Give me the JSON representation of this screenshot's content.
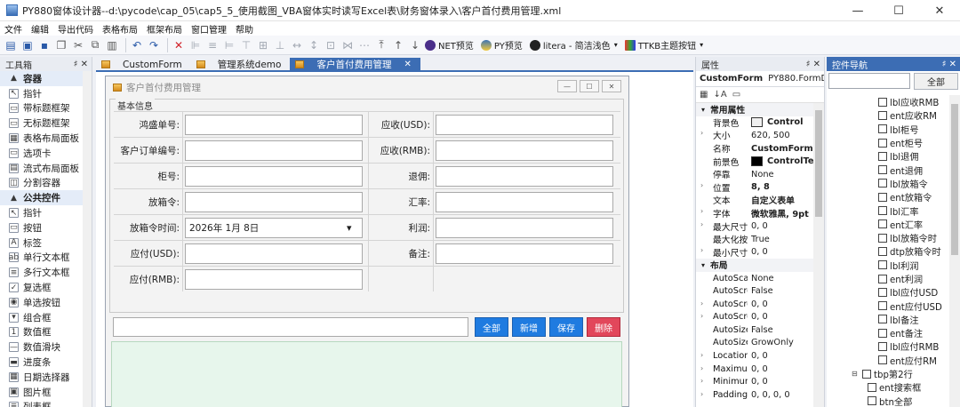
{
  "window": {
    "title": "PY880窗体设计器--d:\\pycode\\cap_05\\cap5_5_使用截图_VBA窗体实时读写Excel表\\财务窗体录入\\客户首付费用管理.xml",
    "minimize": "—",
    "maximize": "☐",
    "close": "✕"
  },
  "menu": [
    "文件",
    "编辑",
    "导出代码",
    "表格布局",
    "框架布局",
    "窗口管理",
    "帮助"
  ],
  "toolbar": {
    "net_preview": "NET预览",
    "py_preview": "PY预览",
    "litera": "litera - 简洁浅色",
    "ttkb": "TTKB主题按钮"
  },
  "toolbox": {
    "title": "工具箱",
    "pin": "♯ ✕",
    "items": [
      {
        "label": "容器",
        "icon": "▲",
        "cat": true
      },
      {
        "label": "指针",
        "icon": "↖"
      },
      {
        "label": "带标题框架",
        "icon": "▭"
      },
      {
        "label": "无标题框架",
        "icon": "▭"
      },
      {
        "label": "表格布局面板",
        "icon": "▦"
      },
      {
        "label": "选项卡",
        "icon": "▭"
      },
      {
        "label": "流式布局面板",
        "icon": "▤"
      },
      {
        "label": "分割容器",
        "icon": "◫"
      },
      {
        "label": "公共控件",
        "icon": "▲",
        "cat": true
      },
      {
        "label": "指针",
        "icon": "↖"
      },
      {
        "label": "按钮",
        "icon": "▭"
      },
      {
        "label": "标签",
        "icon": "A"
      },
      {
        "label": "单行文本框",
        "icon": "ab"
      },
      {
        "label": "多行文本框",
        "icon": "≡"
      },
      {
        "label": "复选框",
        "icon": "✓"
      },
      {
        "label": "单选按钮",
        "icon": "◉"
      },
      {
        "label": "组合框",
        "icon": "▾"
      },
      {
        "label": "数值框",
        "icon": "1"
      },
      {
        "label": "数值滑块",
        "icon": "—"
      },
      {
        "label": "进度条",
        "icon": "▬"
      },
      {
        "label": "日期选择器",
        "icon": "▦"
      },
      {
        "label": "图片框",
        "icon": "▣"
      },
      {
        "label": "列表框",
        "icon": "≣"
      }
    ]
  },
  "tabs": [
    {
      "label": "CustomForm",
      "active": false
    },
    {
      "label": "管理系统demo",
      "active": false
    },
    {
      "label": "客户首付费用管理",
      "active": true
    }
  ],
  "tab_close": "✕",
  "form": {
    "title": "客户首付费用管理",
    "group_label": "基本信息",
    "left_labels": [
      "鸿盛单号:",
      "客户订单编号:",
      "柜号:",
      "放箱令:",
      "放箱令时间:",
      "应付(USD):",
      "应付(RMB):"
    ],
    "right_labels": [
      "应收(USD):",
      "应收(RMB):",
      "退佣:",
      "汇率:",
      "利润:",
      "备注:"
    ],
    "date_value": "2026年  1月  8日",
    "buttons": {
      "all": "全部",
      "add": "新增",
      "save": "保存",
      "delete": "删除"
    }
  },
  "properties": {
    "title": "属性",
    "pin": "♯ ✕",
    "object_name": "CustomForm",
    "object_type": "PY880.FormD",
    "rows": [
      {
        "type": "cat",
        "name": "常用属性"
      },
      {
        "name": "背景色",
        "value": "Control",
        "swatch": "#f0f0f0",
        "bold": true
      },
      {
        "name": "大小",
        "value": "620, 500",
        "expand": true
      },
      {
        "name": "名称",
        "value": "CustomForm",
        "bold": true
      },
      {
        "name": "前景色",
        "value": "ControlTe",
        "swatch": "#000000",
        "bold": true
      },
      {
        "name": "停靠",
        "value": "None"
      },
      {
        "name": "位置",
        "value": "8, 8",
        "expand": true,
        "bold": true
      },
      {
        "name": "文本",
        "value": "自定义表单",
        "bold": true
      },
      {
        "name": "字体",
        "value": "微软雅黑, 9pt",
        "expand": true,
        "bold": true
      },
      {
        "name": "最大尺寸",
        "value": "0, 0",
        "expand": true
      },
      {
        "name": "最大化按",
        "value": "True"
      },
      {
        "name": "最小尺寸",
        "value": "0, 0",
        "expand": true
      },
      {
        "type": "cat",
        "name": "布局"
      },
      {
        "name": "AutoScal",
        "value": "None"
      },
      {
        "name": "AutoScrc",
        "value": "False"
      },
      {
        "name": "AutoScrc",
        "value": "0, 0",
        "expand": true
      },
      {
        "name": "AutoScrc",
        "value": "0, 0",
        "expand": true
      },
      {
        "name": "AutoSize",
        "value": "False"
      },
      {
        "name": "AutoSize",
        "value": "GrowOnly"
      },
      {
        "name": "Location",
        "value": "0, 0",
        "expand": true
      },
      {
        "name": "Maximur",
        "value": "0, 0",
        "expand": true
      },
      {
        "name": "Minimur",
        "value": "0, 0",
        "expand": true
      },
      {
        "name": "Padding",
        "value": "0, 0, 0, 0",
        "expand": true
      }
    ]
  },
  "navigator": {
    "title": "控件导航",
    "pin": "♯ ✕",
    "all_button": "全部",
    "items": [
      {
        "label": "lbl应收RMB",
        "indent": 58
      },
      {
        "label": "ent应收RM",
        "indent": 58
      },
      {
        "label": "lbl柜号",
        "indent": 58
      },
      {
        "label": "ent柜号",
        "indent": 58
      },
      {
        "label": "lbl退佣",
        "indent": 58
      },
      {
        "label": "ent退佣",
        "indent": 58
      },
      {
        "label": "lbl放箱令",
        "indent": 58
      },
      {
        "label": "ent放箱令",
        "indent": 58
      },
      {
        "label": "lbl汇率",
        "indent": 58
      },
      {
        "label": "ent汇率",
        "indent": 58
      },
      {
        "label": "lbl放箱令时",
        "indent": 58
      },
      {
        "label": "dtp放箱令时",
        "indent": 58
      },
      {
        "label": "lbl利润",
        "indent": 58
      },
      {
        "label": "ent利润",
        "indent": 58
      },
      {
        "label": "lbl应付USD",
        "indent": 58
      },
      {
        "label": "ent应付USD",
        "indent": 58
      },
      {
        "label": "lbl备注",
        "indent": 58
      },
      {
        "label": "ent备注",
        "indent": 58
      },
      {
        "label": "lbl应付RMB",
        "indent": 58
      },
      {
        "label": "ent应付RM",
        "indent": 58
      },
      {
        "label": "tbp第2行",
        "indent": 28,
        "group": true
      },
      {
        "label": "ent搜索框",
        "indent": 46
      },
      {
        "label": "btn全部",
        "indent": 46
      }
    ]
  },
  "colors": {
    "accent": "#3c6db4",
    "button_blue": "#1f7be0",
    "button_red": "#e2475b",
    "green_panel": "#e7f6ec"
  }
}
